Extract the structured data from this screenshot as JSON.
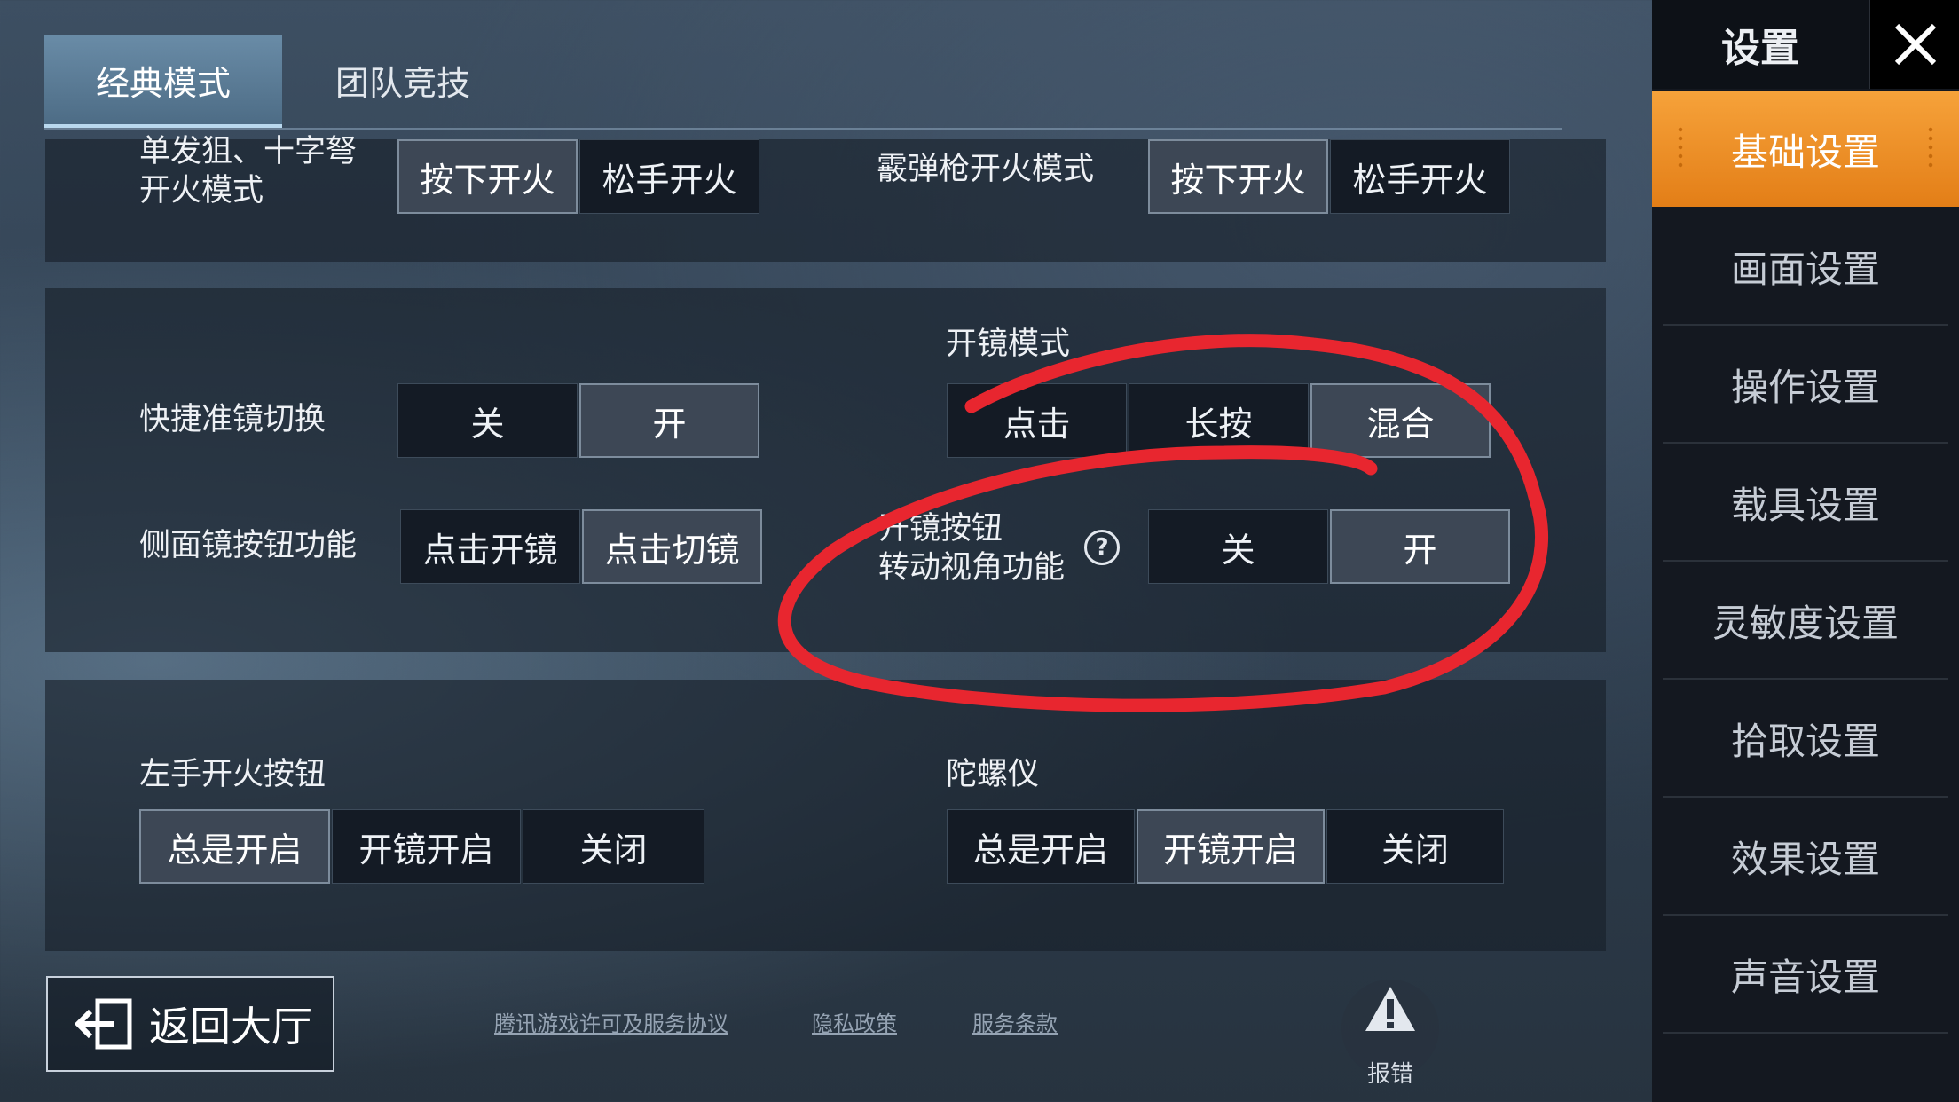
{
  "tabs": [
    {
      "label": "经典模式",
      "active": true
    },
    {
      "label": "团队竞技",
      "active": false
    }
  ],
  "panel1": {
    "row1_label": "单发狙、十字弩\n开火模式",
    "row1_options": [
      "按下开火",
      "松手开火"
    ],
    "row1_selected": 0,
    "row2_label": "霰弹枪开火模式",
    "row2_options": [
      "按下开火",
      "松手开火"
    ],
    "row2_selected": 0
  },
  "panel2": {
    "scope_mode_label": "开镜模式",
    "scope_mode_options": [
      "点击",
      "长按",
      "混合"
    ],
    "scope_mode_selected": 2,
    "quick_scope_label": "快捷准镜切换",
    "quick_scope_options": [
      "关",
      "开"
    ],
    "quick_scope_selected": 1,
    "side_scope_label": "侧面镜按钮功能",
    "side_scope_options": [
      "点击开镜",
      "点击切镜"
    ],
    "side_scope_selected": 1,
    "scope_rotate_label": "开镜按钮\n转动视角功能",
    "scope_rotate_help": "?",
    "scope_rotate_options": [
      "关",
      "开"
    ],
    "scope_rotate_selected": 1
  },
  "panel3": {
    "left_fire_label": "左手开火按钮",
    "left_fire_options": [
      "总是开启",
      "开镜开启",
      "关闭"
    ],
    "left_fire_selected": 0,
    "gyro_label": "陀螺仪",
    "gyro_options": [
      "总是开启",
      "开镜开启",
      "关闭"
    ],
    "gyro_selected": 1
  },
  "footer": {
    "back_label": "返回大厅",
    "links": [
      "腾讯游戏许可及服务协议",
      "隐私政策",
      "服务条款"
    ],
    "report_label": "报错"
  },
  "sidebar": {
    "title": "设置",
    "items": [
      {
        "label": "基础设置",
        "active": true
      },
      {
        "label": "画面设置",
        "active": false
      },
      {
        "label": "操作设置",
        "active": false
      },
      {
        "label": "载具设置",
        "active": false
      },
      {
        "label": "灵敏度设置",
        "active": false
      },
      {
        "label": "拾取设置",
        "active": false
      },
      {
        "label": "效果设置",
        "active": false
      },
      {
        "label": "声音设置",
        "active": false
      }
    ]
  },
  "colors": {
    "accent_orange": "#f39a2f",
    "annotation_red": "#e8262f",
    "selected_segment": "#3d4755"
  }
}
